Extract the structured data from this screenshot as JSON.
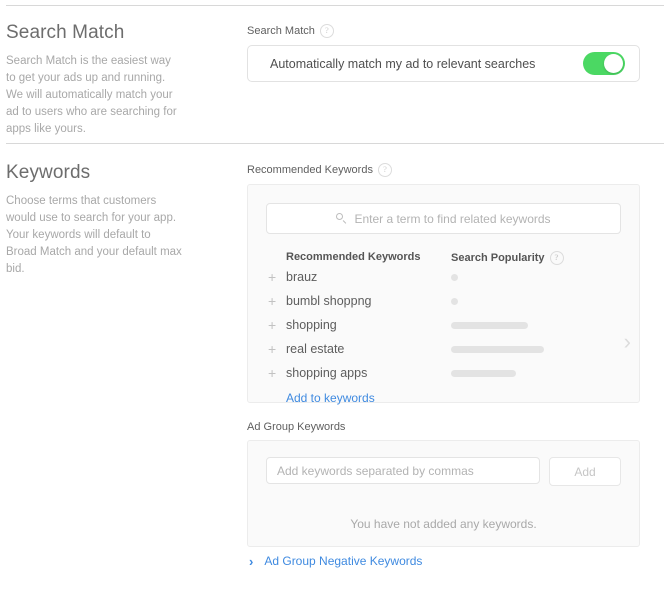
{
  "colors": {
    "toggle_on": "#4bd863",
    "link_blue": "#3f8ae0",
    "panel_bg": "#fafafa",
    "bar_gray": "#e3e3e3"
  },
  "search_match": {
    "heading": "Search Match",
    "description": "Search Match is the easiest way to get your ads up and running. We will automatically match your ad to users who are searching for apps like yours.",
    "field_label": "Search Match",
    "help_glyph": "?",
    "option_label": "Automatically match my ad to relevant searches",
    "toggle_state": "on"
  },
  "keywords": {
    "heading": "Keywords",
    "description": "Choose terms that customers would use to search for your app. Your keywords will default to Broad Match and your default max bid.",
    "recommended": {
      "field_label": "Recommended Keywords",
      "help_glyph": "?",
      "search_placeholder": "Enter a term to find related keywords",
      "search_icon": "search-icon",
      "col_keyword": "Recommended Keywords",
      "col_popularity": "Search Popularity",
      "popularity_help_glyph": "?",
      "add_icon": "+",
      "rows": [
        {
          "keyword": "brauz",
          "popularity_width": 7
        },
        {
          "keyword": "bumbl shoppng",
          "popularity_width": 7
        },
        {
          "keyword": "shopping",
          "popularity_width": 77
        },
        {
          "keyword": "real estate",
          "popularity_width": 93
        },
        {
          "keyword": "shopping apps",
          "popularity_width": 65
        }
      ],
      "add_to_keywords": "Add to keywords",
      "next_page_glyph": "›"
    },
    "ad_group": {
      "field_label": "Ad Group Keywords",
      "input_placeholder": "Add keywords separated by commas",
      "input_value": "",
      "add_button": "Add",
      "add_button_disabled": true,
      "empty_message": "You have not added any keywords."
    },
    "negative": {
      "chevron_glyph": "›",
      "label": "Ad Group Negative Keywords"
    }
  }
}
